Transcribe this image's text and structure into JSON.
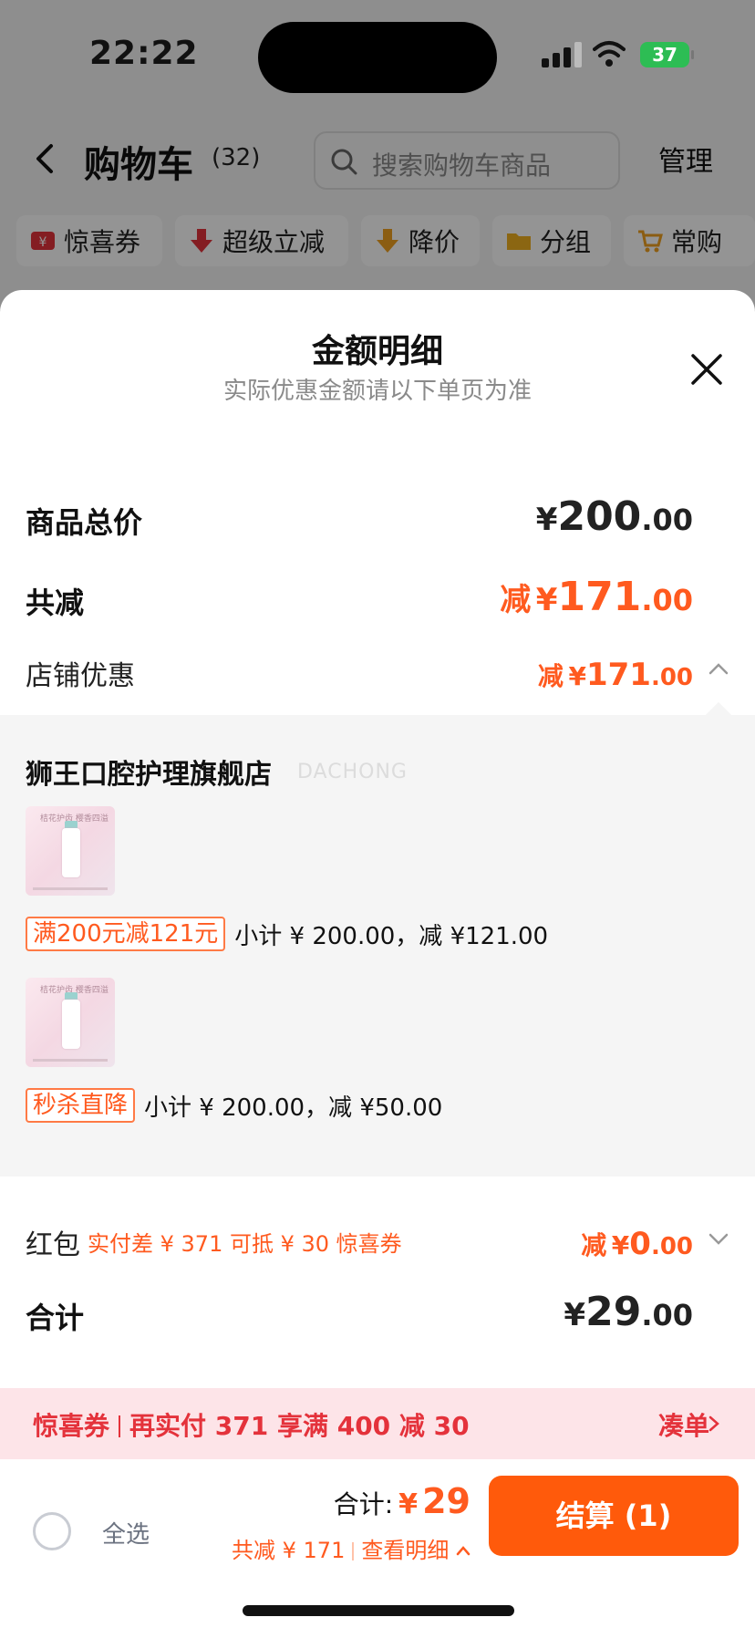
{
  "status_bar": {
    "time": "22:22",
    "battery": "37"
  },
  "nav": {
    "title": "购物车",
    "count": "(32)",
    "search_placeholder": "搜索购物车商品",
    "manage": "管理"
  },
  "chips": [
    {
      "label": "惊喜券",
      "icon": "coupon-icon",
      "color": "#e4323b"
    },
    {
      "label": "超级立减",
      "icon": "down-arrow-icon",
      "color": "#e4323b"
    },
    {
      "label": "降价",
      "icon": "price-drop-icon",
      "color": "#f0a020"
    },
    {
      "label": "分组",
      "icon": "folder-icon",
      "color": "#f0b020"
    },
    {
      "label": "常购",
      "icon": "cart-plus-icon",
      "color": "#f0a020"
    }
  ],
  "sheet": {
    "title": "金额明细",
    "subtitle": "实际优惠金额请以下单页为准",
    "goods_total": {
      "label": "商品总价",
      "yen": "¥",
      "int": "200",
      "dec": ".00"
    },
    "total_discount": {
      "label": "共减",
      "prefix": "减",
      "yen": "¥",
      "int": "171",
      "dec": ".00"
    },
    "shop_discount": {
      "label": "店铺优惠",
      "prefix": "减",
      "yen": "¥",
      "int": "171",
      "dec": ".00"
    },
    "shop": {
      "name": "狮王口腔护理旗舰店",
      "watermark": "DACHONG",
      "thumb_text": "桔花护齿 樱香四溢",
      "items": [
        {
          "tag": "满200元减121元",
          "text": "小计 ¥ 200.00，减 ¥121.00"
        },
        {
          "tag": "秒杀直降",
          "text": "小计 ¥ 200.00，减 ¥50.00"
        }
      ]
    },
    "red_packet": {
      "label": "红包",
      "note": "实付差 ¥ 371 可抵 ¥ 30 惊喜券",
      "prefix": "减",
      "yen": "¥",
      "int": "0",
      "dec": ".00"
    },
    "grand_total": {
      "label": "合计",
      "yen": "¥",
      "int": "29",
      "dec": ".00"
    }
  },
  "coupon_bar": {
    "tag": "惊喜券",
    "text": "再实付 371 享满 400 减 30",
    "link": "凑单"
  },
  "checkout": {
    "select_all": "全选",
    "total_label": "合计:",
    "total_yen": "¥",
    "total_value": "29",
    "saved": "共减 ¥ 171",
    "view_detail": "查看明细",
    "pay_button": "结算 (1)"
  },
  "colors": {
    "accent": "#ff5a1f",
    "coupon_red": "#e4323b",
    "coupon_bg": "#fde4e8"
  }
}
